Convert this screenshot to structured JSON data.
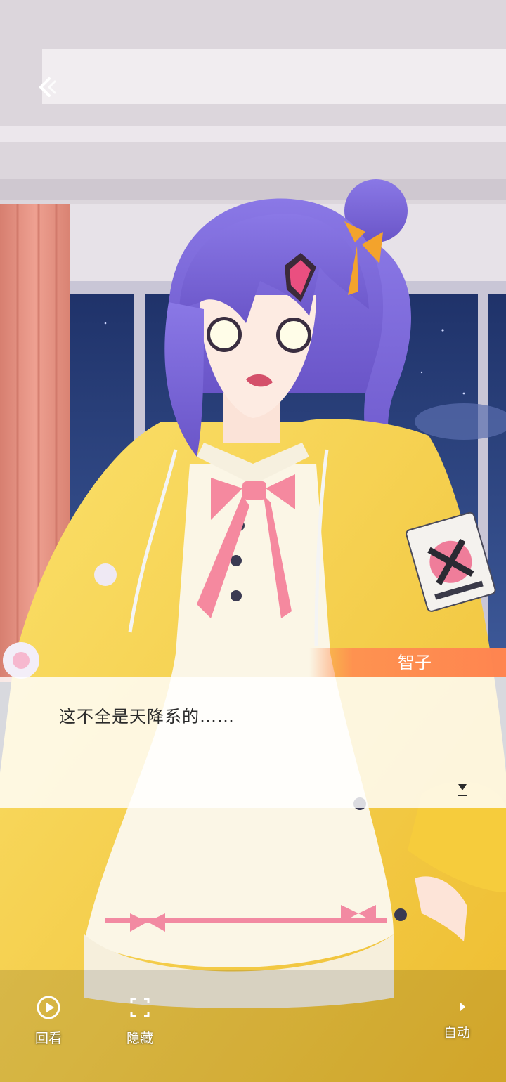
{
  "dialog": {
    "speaker": "智子",
    "text": "这不全是天降系的……"
  },
  "controls": {
    "review": "回看",
    "hide": "隐藏",
    "auto": "自动"
  },
  "icons": {
    "back": "back-icon",
    "review": "play-circle-icon",
    "hide": "fullscreen-corners-icon",
    "auto": "play-triangle-icon",
    "next": "next-arrow-icon"
  },
  "colors": {
    "name_tag": "#ff8550",
    "hair": "#7a66d8",
    "jacket": "#f7d245",
    "dress": "#fbf6e6",
    "bow": "#f5899f",
    "curtain": "#e59282",
    "night_sky": "#243a78"
  }
}
